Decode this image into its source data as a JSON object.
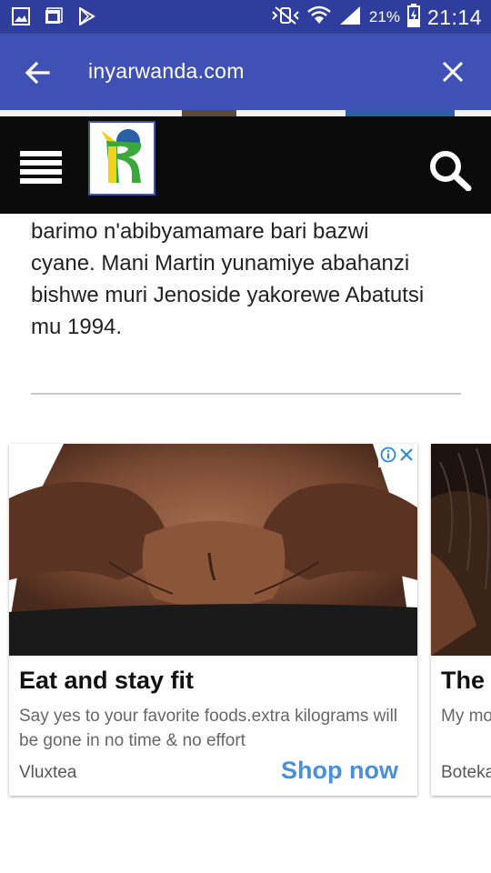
{
  "status_bar": {
    "battery_percent": "21%",
    "time": "21:14",
    "icons": [
      "gallery-icon",
      "photos-icon",
      "play-store-icon",
      "vibrate-mute-icon",
      "wifi-icon",
      "signal-icon",
      "battery-charging-icon"
    ]
  },
  "url_bar": {
    "url": "inyarwanda.com",
    "back_icon": "arrow-left-icon",
    "close_icon": "close-icon"
  },
  "site_header": {
    "menu_icon": "hamburger-menu-icon",
    "logo_letter": "R",
    "search_icon": "search-icon"
  },
  "article": {
    "lines": [
      "barimo n'abibyamamare bari bazwi",
      "cyane. Mani Martin yunamiye abahanzi",
      "bishwe muri Jenoside yakorewe Abatutsi",
      "mu 1994."
    ]
  },
  "ads": [
    {
      "title": "Eat and stay fit",
      "description": "Say yes to your favorite foods.extra kilograms will be gone in no time & no effort",
      "brand": "Vluxtea",
      "cta": "Shop now"
    },
    {
      "title": "The",
      "description": "My mo gray ha",
      "brand": "Boteka"
    }
  ],
  "colors": {
    "status_bar": "#2f3d9c",
    "url_bar": "#3f51b5",
    "site_header": "#0b0b0b",
    "cta": "#4a90d9",
    "adchoices": "#2a8ad8"
  }
}
